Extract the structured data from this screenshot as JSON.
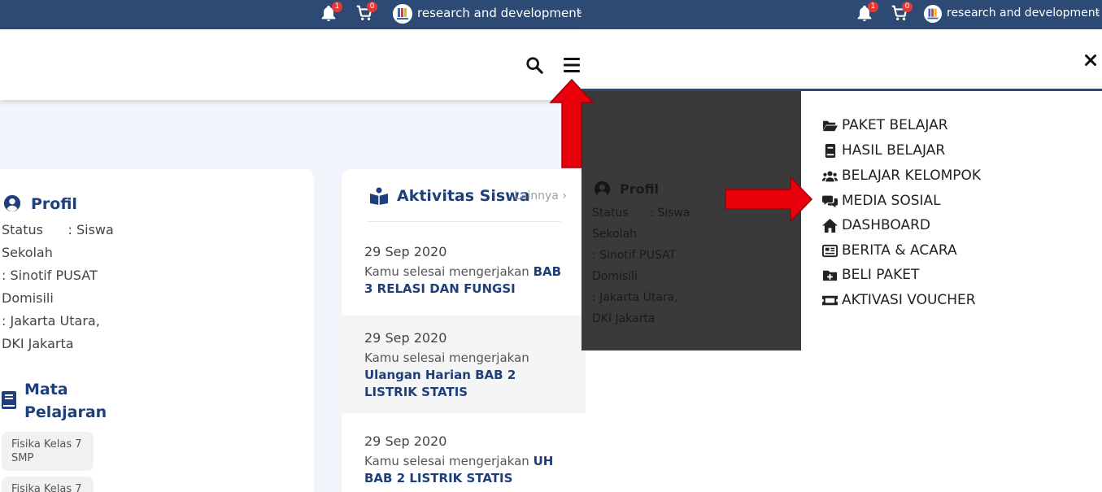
{
  "topbar": {
    "notif_count": "1",
    "cart_count": "0",
    "user_name": "research and development"
  },
  "profile": {
    "title": "Profil",
    "status_line": "Status      : Siswa",
    "school_label": "Sekolah",
    "school_value": ": Sinotif PUSAT",
    "domicile_label": "Domisili",
    "domicile_value_1": ": Jakarta Utara,",
    "domicile_value_2": "DKI Jakarta"
  },
  "subjects": {
    "title_1": "Mata",
    "title_2": "Pelajaran",
    "items": [
      "Fisika Kelas 7 SMP",
      "Fisika Kelas 7"
    ]
  },
  "activity": {
    "title": "Aktivitas Siswa",
    "more_link": "Lainnya",
    "items": [
      {
        "date": "29 Sep 2020",
        "prefix": "Kamu selesai mengerjakan",
        "subject": "BAB 3 RELASI DAN FUNGSI"
      },
      {
        "date": "29 Sep 2020",
        "prefix": "Kamu selesai mengerjakan",
        "subject": "Ulangan Harian BAB 2 LISTRIK STATIS"
      },
      {
        "date": "29 Sep 2020",
        "prefix": "Kamu selesai mengerjakan",
        "subject": "UH BAB 2 LISTRIK STATIS"
      }
    ]
  },
  "menu": {
    "items": [
      "PAKET BELAJAR",
      "HASIL BELAJAR",
      "BELAJAR KELOMPOK",
      "MEDIA SOSIAL",
      "DASHBOARD",
      "BERITA & ACARA",
      "BELI PAKET",
      "AKTIVASI VOUCHER"
    ]
  },
  "icons": {
    "notification": "bell-icon",
    "cart": "cart-icon",
    "search": "search-icon",
    "menu": "hamburger-icon",
    "close": "close-icon"
  },
  "colors": {
    "topbar": "#2d4a75",
    "accent": "#1f3f7a",
    "badge": "#e53935",
    "annotation_arrow": "#e8000b",
    "page_background": "#f1f5fc"
  }
}
